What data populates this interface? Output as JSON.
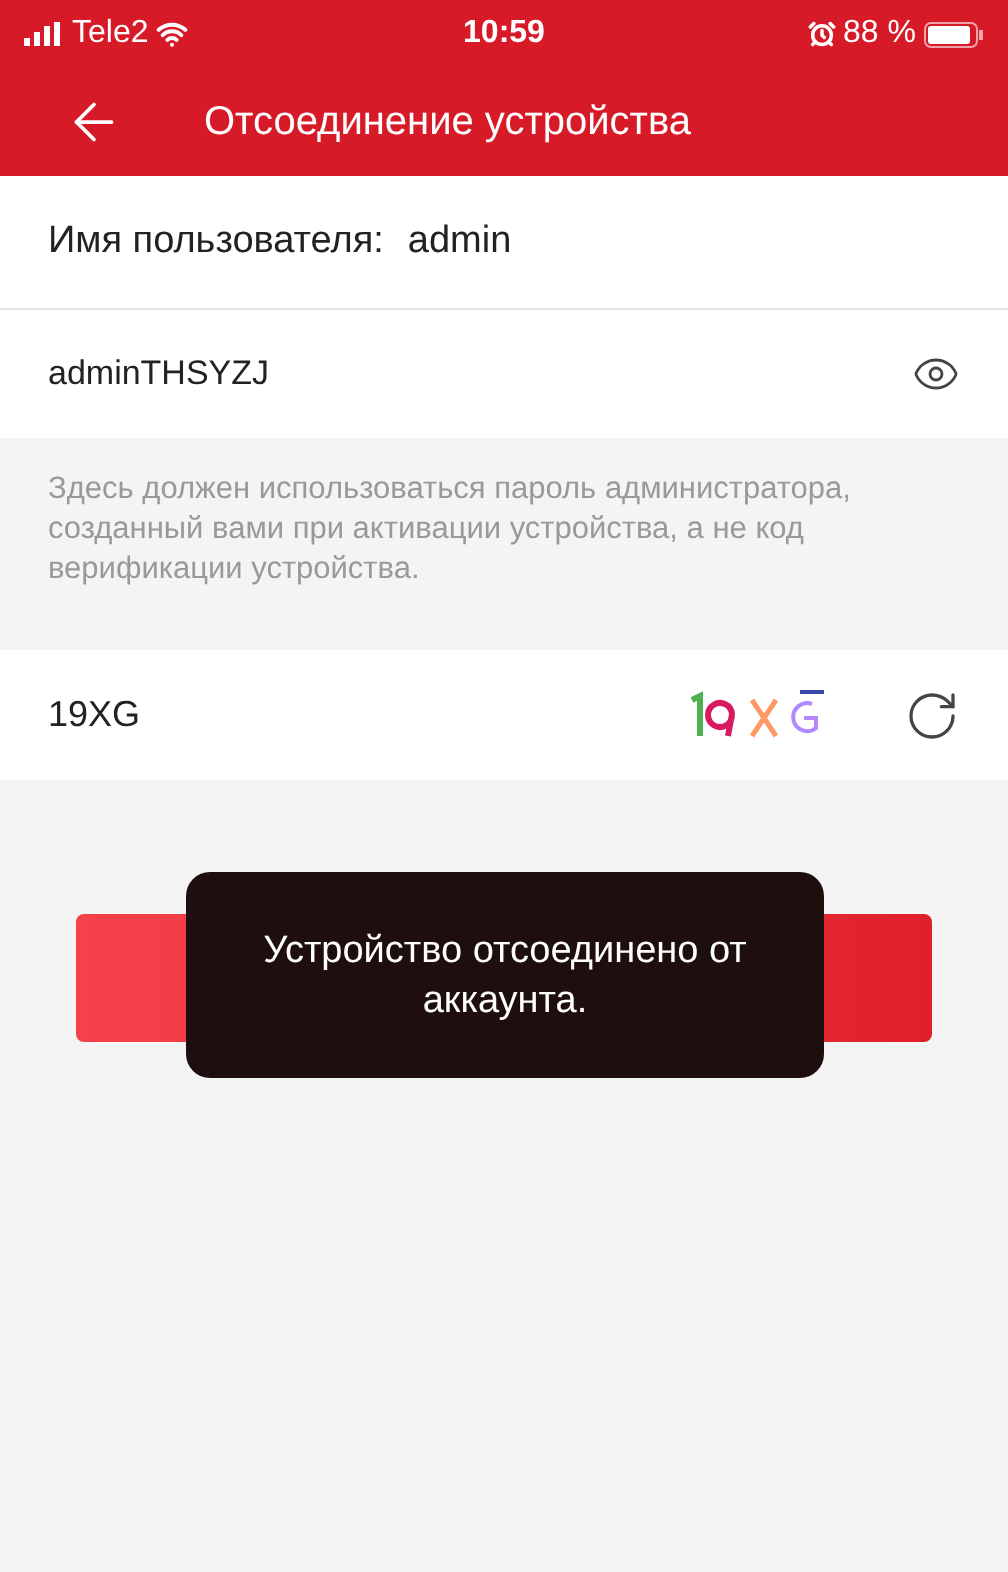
{
  "status_bar": {
    "carrier": "Tele2",
    "time": "10:59",
    "battery": "88 %"
  },
  "header": {
    "title": "Отсоединение устройства"
  },
  "username": {
    "label": "Имя пользователя:",
    "value": "admin"
  },
  "password": {
    "value": "adminTHSYZJ"
  },
  "hint": "Здесь должен использоваться пароль администратора, созданный вами при активации устройства, а не код верификации устройства.",
  "captcha": {
    "value": "19XG"
  },
  "toast": {
    "message": "Устройство отсоединено от аккаунта."
  }
}
